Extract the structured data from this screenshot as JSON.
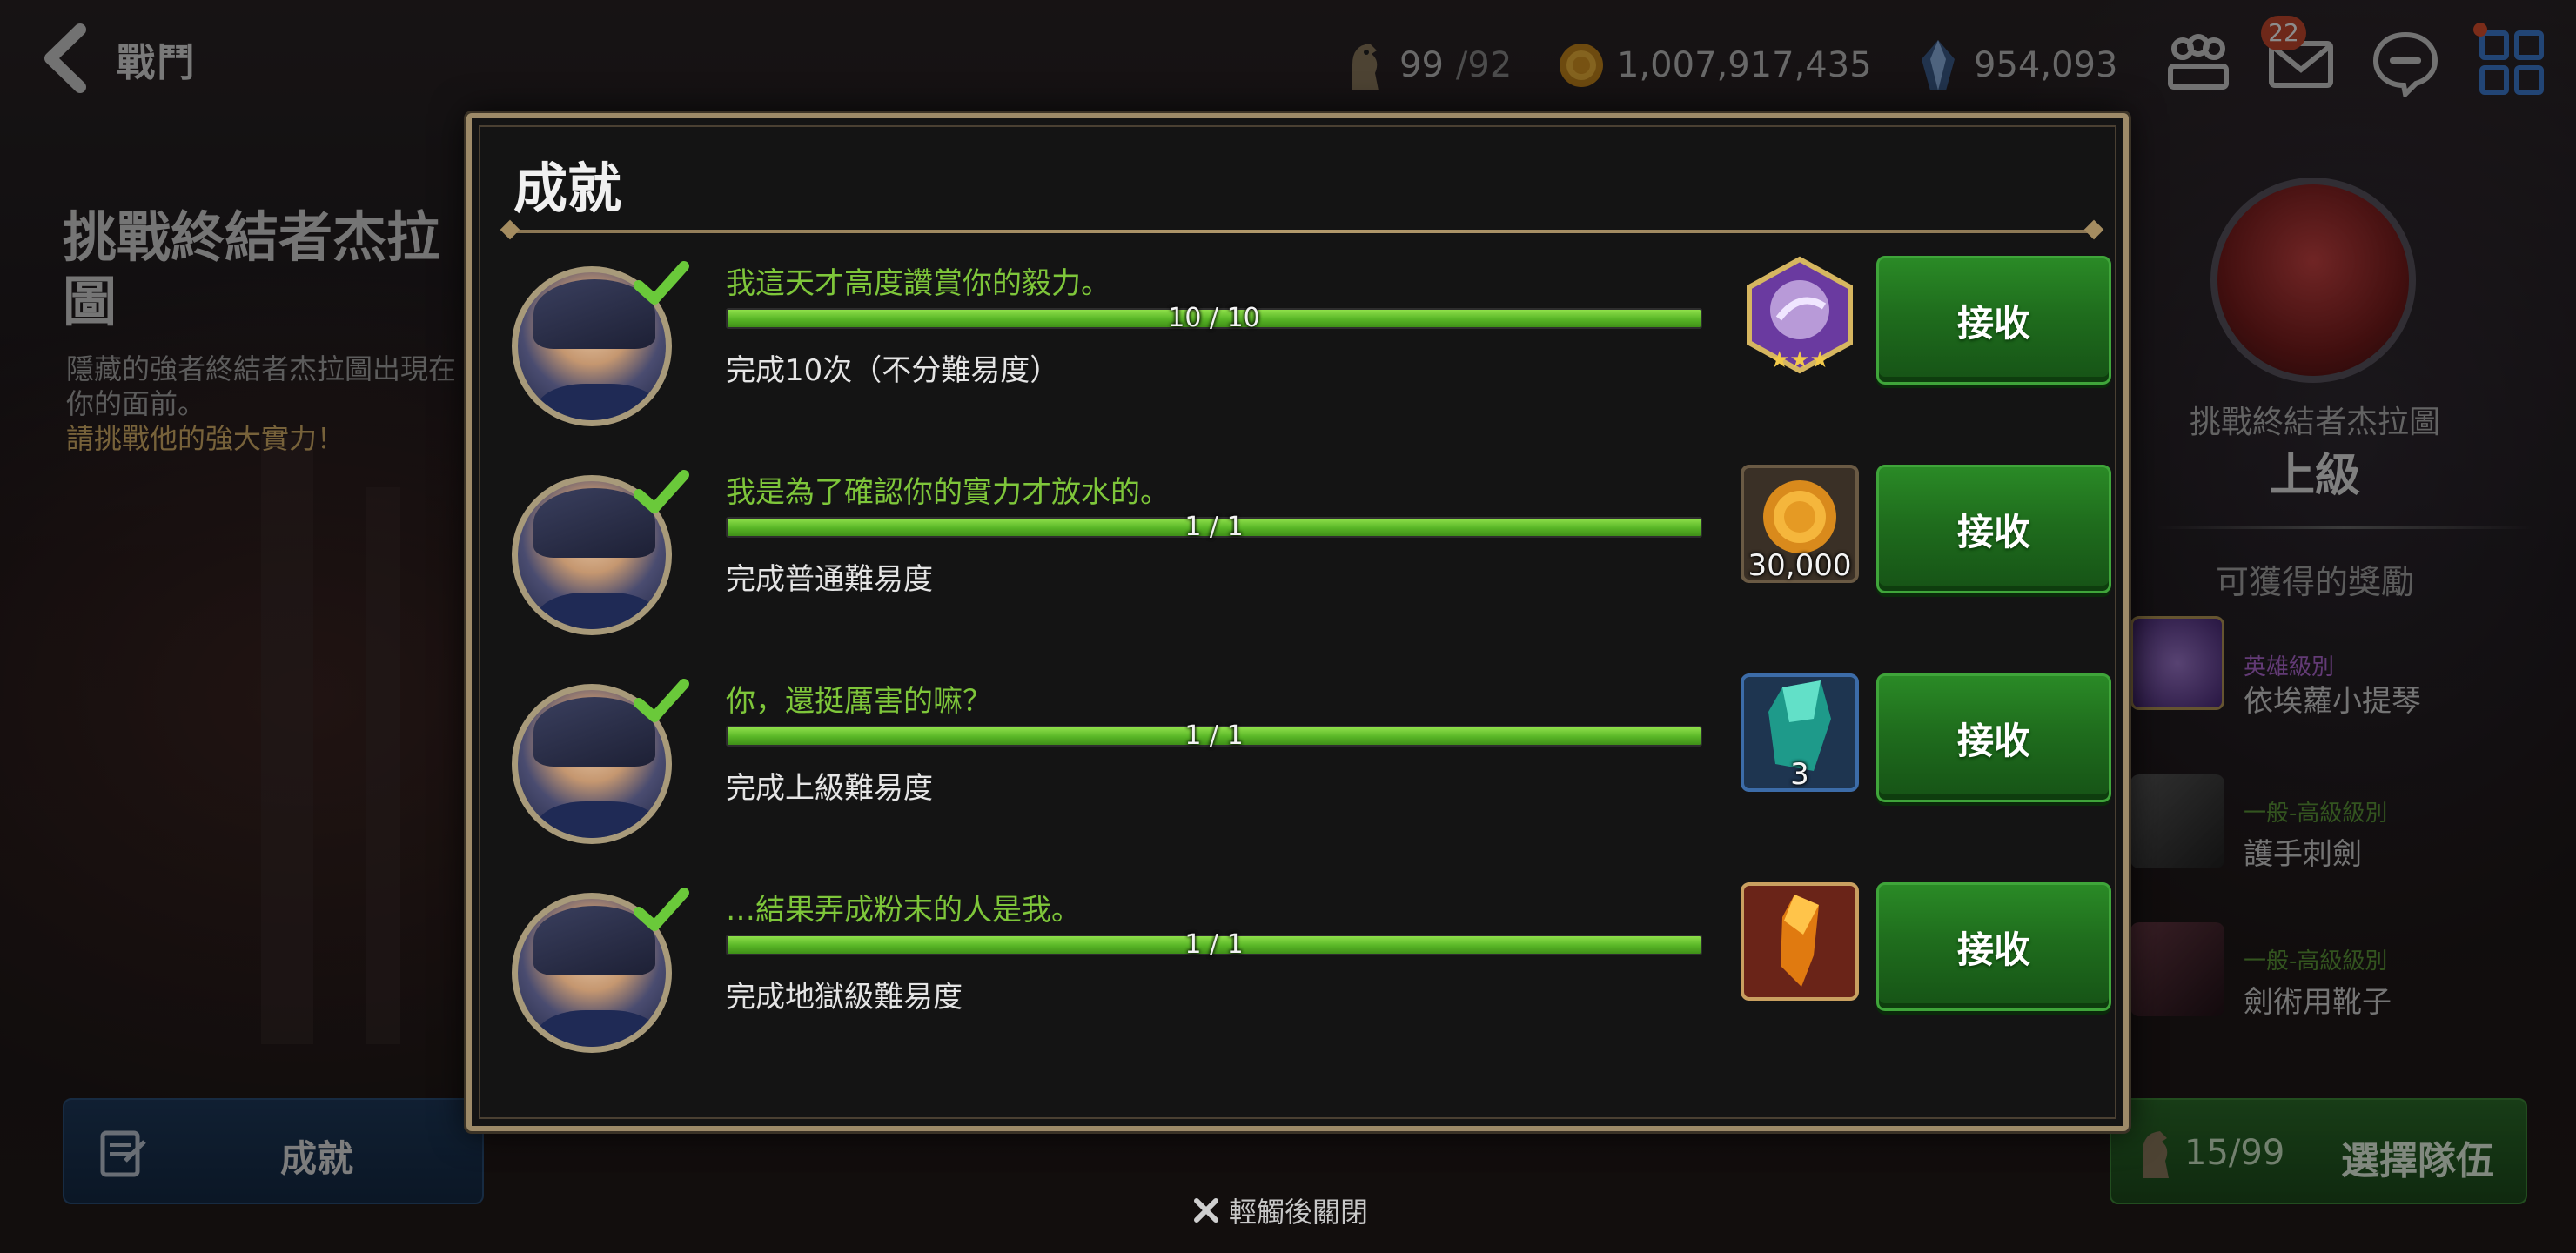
{
  "topbar": {
    "back_label": "戰鬥",
    "stamina": {
      "value": "99",
      "cap": "/92"
    },
    "gold": "1,007,917,435",
    "crystal": "954,093",
    "mail_badge": "22"
  },
  "stage": {
    "title": "挑戰終結者杰拉圖",
    "desc_lines": [
      "隱藏的強者終結者杰拉圖出現在",
      "你的面前。",
      "請挑戰他的強大實力！"
    ]
  },
  "achievement_tab": {
    "label": "成就"
  },
  "right_panel": {
    "name": "挑戰終結者杰拉圖",
    "difficulty": "上級",
    "rewards_title": "可獲得的獎勵",
    "items": [
      {
        "grade": "英雄級別",
        "name": "依埃蘿小提琴"
      },
      {
        "grade": "一般-高級級別",
        "name": "護手刺劍"
      },
      {
        "grade": "一般-高級級別",
        "name": "劍術用靴子"
      }
    ],
    "team_count": "15/99",
    "team_label": "選擇隊伍"
  },
  "modal": {
    "title": "成就",
    "rows": [
      {
        "name": "我這天才高度讚賞你的毅力。",
        "progress_text": "10 / 10",
        "progress": 1.0,
        "desc": "完成10次（不分難易度）",
        "reward_icon": "hero-violin-icon",
        "reward_qty": "",
        "claim": "接收"
      },
      {
        "name": "我是為了確認你的實力才放水的。",
        "progress_text": "1 / 1",
        "progress": 1.0,
        "desc": "完成普通難易度",
        "reward_icon": "gold-coin-icon",
        "reward_qty": "30,000",
        "claim": "接收"
      },
      {
        "name": "你，還挺厲害的嘛？",
        "progress_text": "1 / 1",
        "progress": 1.0,
        "desc": "完成上級難易度",
        "reward_icon": "crystal-icon",
        "reward_qty": "3",
        "claim": "接收"
      },
      {
        "name": "…結果弄成粉末的人是我。",
        "progress_text": "1 / 1",
        "progress": 1.0,
        "desc": "完成地獄級難易度",
        "reward_icon": "orange-crystal-icon",
        "reward_qty": "",
        "claim": "接收"
      }
    ],
    "close_hint": "輕觸後關閉"
  },
  "colors": {
    "accent_green": "#7ec63a",
    "button_green": "#1f6d1d",
    "frame_gold": "#9d8a68"
  }
}
